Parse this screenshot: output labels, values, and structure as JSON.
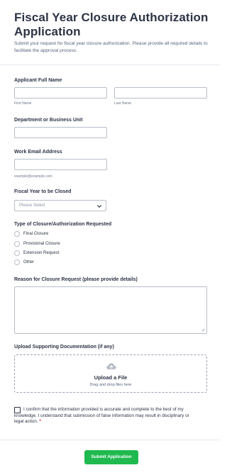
{
  "header": {
    "title": "Fiscal Year Closure Authorization Application",
    "subtitle": "Submit your request for fiscal year closure authorization. Please provide all required details to facilitate the approval process."
  },
  "applicant": {
    "label": "Applicant Full Name",
    "first_sublabel": "First Name",
    "last_sublabel": "Last Name",
    "first_value": "",
    "last_value": ""
  },
  "department": {
    "label": "Department or Business Unit",
    "value": ""
  },
  "email": {
    "label": "Work Email Address",
    "sublabel": "example@example.com",
    "value": ""
  },
  "fiscal_year": {
    "label": "Fiscal Year to be Closed",
    "selected": "Please Select"
  },
  "closure_type": {
    "label": "Type of Closure/Authorization Requested",
    "options": [
      "Final Closure",
      "Provisional Closure",
      "Extension Request",
      "Other"
    ]
  },
  "reason": {
    "label": "Reason for Closure Request (please provide details)",
    "value": ""
  },
  "upload": {
    "label": "Upload Supporting Documentation (if any)",
    "title": "Upload a File",
    "subtitle": "Drag and drop files here",
    "icon": "cloud-upload-icon"
  },
  "consent": {
    "text": "I confirm that the information provided is accurate and complete to the best of my knowledge. I understand that submission of false information may result in disciplinary or legal action.",
    "required_mark": "*"
  },
  "submit": {
    "label": "Submit Application"
  },
  "colors": {
    "accent_green": "#1fb94f",
    "required_red": "#e2192c",
    "text_dark": "#2c3345",
    "border": "#b8bdc9"
  }
}
